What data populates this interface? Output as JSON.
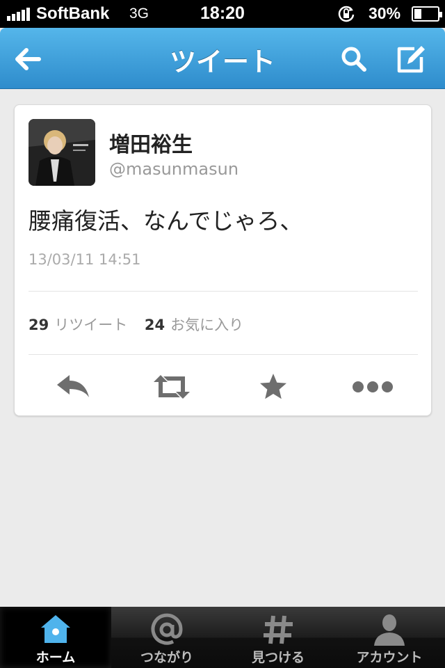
{
  "status_bar": {
    "carrier": "SoftBank",
    "network": "3G",
    "time": "18:20",
    "battery": "30%",
    "battery_level": 0.3
  },
  "nav": {
    "title": "ツイート",
    "icons": [
      "back-arrow-icon",
      "search-icon",
      "compose-icon"
    ]
  },
  "tweet": {
    "name": "増田裕生",
    "handle": "@masunmasun",
    "text": "腰痛復活、なんでじゃろ、",
    "timestamp": "13/03/11 14:51",
    "retweet_count": "29",
    "retweet_label": "リツイート",
    "favorite_count": "24",
    "favorite_label": "お気に入り",
    "actions": [
      "reply-icon",
      "retweet-icon",
      "favorite-icon",
      "more-icon"
    ]
  },
  "tabs": [
    {
      "label": "ホーム",
      "icon": "home-icon",
      "active": true
    },
    {
      "label": "つながり",
      "icon": "at-icon",
      "active": false
    },
    {
      "label": "見つける",
      "icon": "hash-icon",
      "active": false
    },
    {
      "label": "アカウント",
      "icon": "account-icon",
      "active": false
    }
  ],
  "colors": {
    "nav_blue": "#2e8ccc",
    "home_active": "#4fb3ec"
  }
}
